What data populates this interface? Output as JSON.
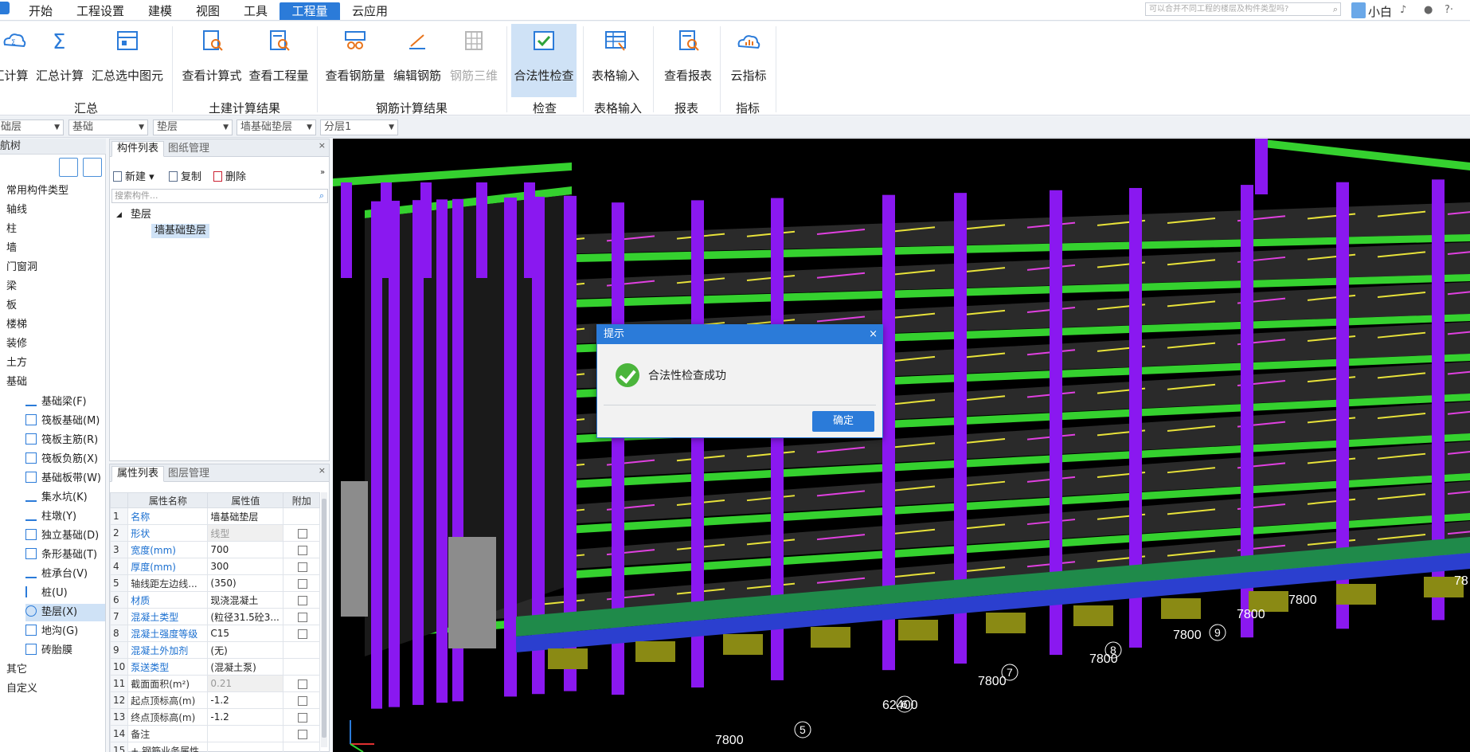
{
  "menu": {
    "items": [
      "开始",
      "工程设置",
      "建模",
      "视图",
      "工具",
      "工程量",
      "云应用"
    ],
    "active_index": 5,
    "search_placeholder": "可以合并不同工程的楼层及构件类型吗?",
    "user_name": "小白"
  },
  "ribbon": {
    "buttons": [
      {
        "label": "汇计算",
        "icon": "cloud-sigma-icon"
      },
      {
        "label": "汇总计算",
        "icon": "sigma-icon"
      },
      {
        "label": "汇总选中图元",
        "icon": "select-sum-icon"
      },
      {
        "label": "查看计算式",
        "icon": "view-formula-icon"
      },
      {
        "label": "查看工程量",
        "icon": "view-quantity-icon"
      },
      {
        "label": "查看钢筋量",
        "icon": "view-rebar-icon"
      },
      {
        "label": "编辑钢筋",
        "icon": "edit-rebar-icon"
      },
      {
        "label": "钢筋三维",
        "icon": "rebar-3d-icon",
        "disabled": true
      },
      {
        "label": "合法性检查",
        "icon": "check-icon",
        "active": true
      },
      {
        "label": "表格输入",
        "icon": "table-input-icon"
      },
      {
        "label": "查看报表",
        "icon": "view-report-icon"
      },
      {
        "label": "云指标",
        "icon": "cloud-index-icon"
      }
    ],
    "groups": [
      "汇总",
      "土建计算结果",
      "钢筋计算结果",
      "检查",
      "表格输入",
      "报表",
      "指标"
    ]
  },
  "filters": [
    "础层",
    "基础",
    "垫层",
    "墙基础垫层",
    "分层1"
  ],
  "nav": {
    "title": "航树",
    "items": [
      "常用构件类型",
      "轴线",
      "柱",
      "墙",
      "门窗洞",
      "梁",
      "板",
      "楼梯",
      "装修",
      "土方",
      "基础"
    ],
    "sub_items": [
      "基础梁(F)",
      "筏板基础(M)",
      "筏板主筋(R)",
      "筏板负筋(X)",
      "基础板带(W)",
      "集水坑(K)",
      "柱墩(Y)",
      "独立基础(D)",
      "条形基础(T)",
      "桩承台(V)",
      "桩(U)",
      "垫层(X)",
      "地沟(G)",
      "砖胎膜"
    ],
    "selected_sub_index": 11,
    "tail_items": [
      "其它",
      "自定义"
    ]
  },
  "component_panel": {
    "tabs": [
      "构件列表",
      "图纸管理"
    ],
    "tools": [
      "新建",
      "复制",
      "删除"
    ],
    "search_placeholder": "搜索构件...",
    "tree": {
      "parent": "垫层",
      "child": "墙基础垫层"
    }
  },
  "property_panel": {
    "tabs": [
      "属性列表",
      "图层管理"
    ],
    "headers": [
      "属性名称",
      "属性值",
      "附加"
    ],
    "rows": [
      {
        "n": "1",
        "name": "名称",
        "value": "墙基础垫层",
        "link": true,
        "gray": false,
        "chk": false
      },
      {
        "n": "2",
        "name": "形状",
        "value": "线型",
        "link": true,
        "gray": true,
        "chk": true
      },
      {
        "n": "3",
        "name": "宽度(mm)",
        "value": "700",
        "link": true,
        "gray": false,
        "chk": true
      },
      {
        "n": "4",
        "name": "厚度(mm)",
        "value": "300",
        "link": true,
        "gray": false,
        "chk": true
      },
      {
        "n": "5",
        "name": "轴线距左边线...",
        "value": "(350)",
        "link": false,
        "gray": false,
        "chk": true
      },
      {
        "n": "6",
        "name": "材质",
        "value": "现浇混凝土",
        "link": true,
        "gray": false,
        "chk": true
      },
      {
        "n": "7",
        "name": "混凝土类型",
        "value": "(粒径31.5砼3...",
        "link": true,
        "gray": false,
        "chk": true
      },
      {
        "n": "8",
        "name": "混凝土强度等级",
        "value": "C15",
        "link": true,
        "gray": false,
        "chk": true
      },
      {
        "n": "9",
        "name": "混凝土外加剂",
        "value": "(无)",
        "link": true,
        "gray": false,
        "chk": false
      },
      {
        "n": "10",
        "name": "泵送类型",
        "value": "(混凝土泵)",
        "link": true,
        "gray": false,
        "chk": false
      },
      {
        "n": "11",
        "name": "截面面积(m²)",
        "value": "0.21",
        "link": false,
        "gray": true,
        "chk": true
      },
      {
        "n": "12",
        "name": "起点顶标高(m)",
        "value": "-1.2",
        "link": false,
        "gray": false,
        "chk": true
      },
      {
        "n": "13",
        "name": "终点顶标高(m)",
        "value": "-1.2",
        "link": false,
        "gray": false,
        "chk": true
      },
      {
        "n": "14",
        "name": "备注",
        "value": "",
        "link": false,
        "gray": false,
        "chk": true
      },
      {
        "n": "15",
        "name": "+ 钢筋业务属性",
        "value": "",
        "link": false,
        "gray": false,
        "chk": false
      }
    ]
  },
  "viewport": {
    "axis_labels": [
      "7800",
      "62400",
      "7800",
      "7800",
      "7800",
      "7800",
      "7800",
      "78"
    ],
    "axis_numbers": [
      "5",
      "6",
      "7",
      "8",
      "9"
    ]
  },
  "dialog": {
    "title": "提示",
    "message": "合法性检查成功",
    "ok_label": "确定",
    "close_symbol": "×"
  },
  "colors": {
    "accent": "#2b7bd9",
    "beam_green": "#35d12f",
    "column_purple": "#8a18f0",
    "rebar_yellow": "#e8e23a",
    "rebar_magenta": "#e040e0",
    "success_green": "#4bb53c"
  }
}
